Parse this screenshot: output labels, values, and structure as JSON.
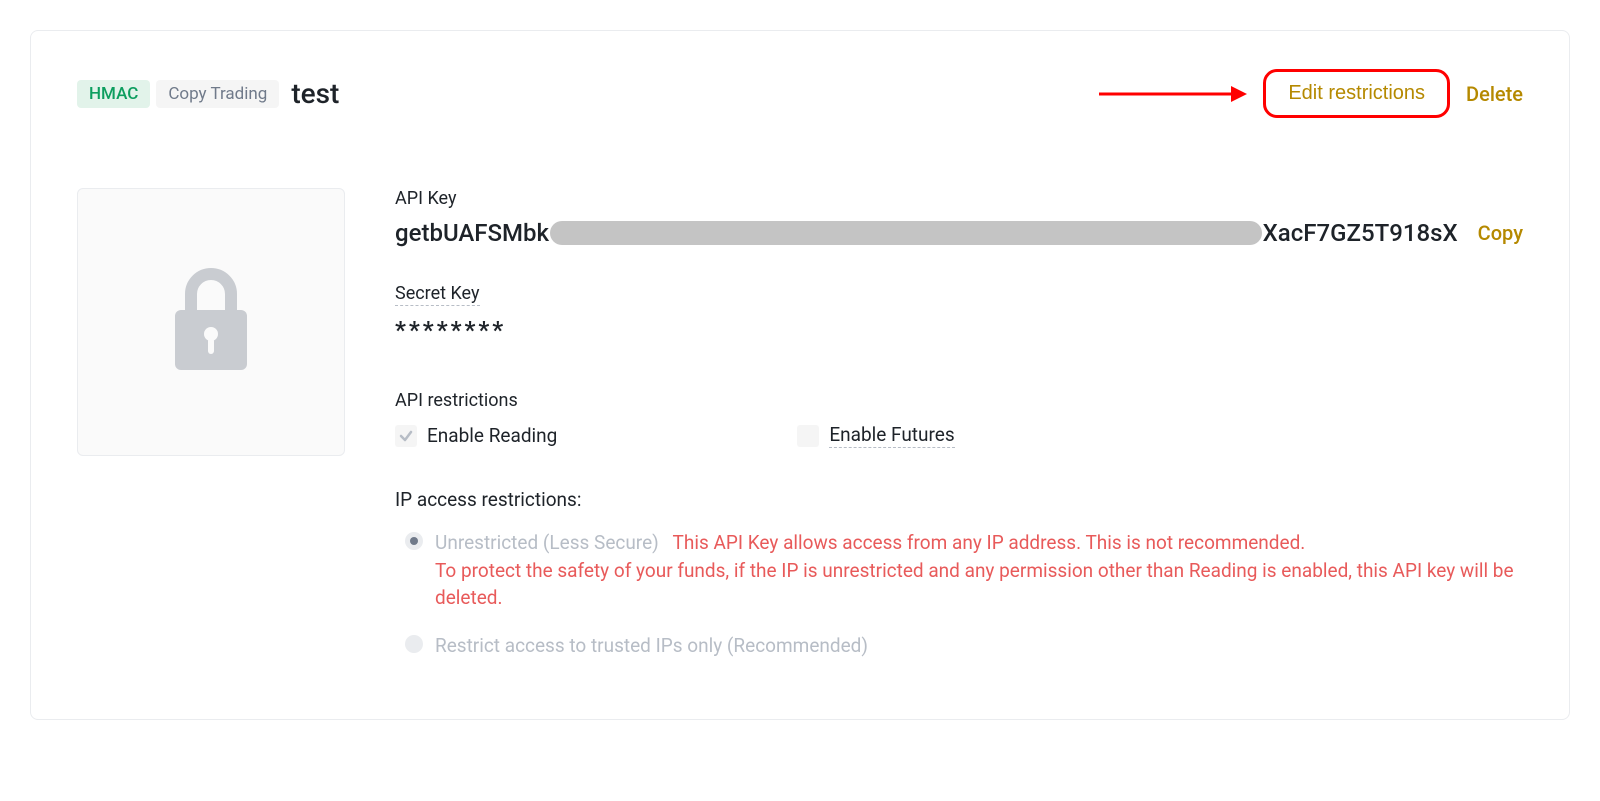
{
  "header": {
    "hmac_badge": "HMAC",
    "copy_trading_badge": "Copy Trading",
    "key_name": "test",
    "edit_label": "Edit restrictions",
    "delete_label": "Delete"
  },
  "api_key": {
    "label": "API Key",
    "prefix": "getbUAFSMbk",
    "suffix": "XacF7GZ5T918sX",
    "copy_label": "Copy"
  },
  "secret_key": {
    "label": "Secret Key",
    "value": "********"
  },
  "restrictions": {
    "title": "API restrictions",
    "enable_reading": "Enable Reading",
    "enable_futures": "Enable Futures"
  },
  "ip": {
    "title": "IP access restrictions:",
    "unrestricted_label": "Unrestricted (Less Secure)",
    "unrestricted_warn1": "This API Key allows access from any IP address. This is not recommended.",
    "unrestricted_warn2": "To protect the safety of your funds, if the IP is unrestricted and any permission other than Reading is enabled, this API key will be deleted.",
    "restrict_label": "Restrict access to trusted IPs only (Recommended)"
  }
}
